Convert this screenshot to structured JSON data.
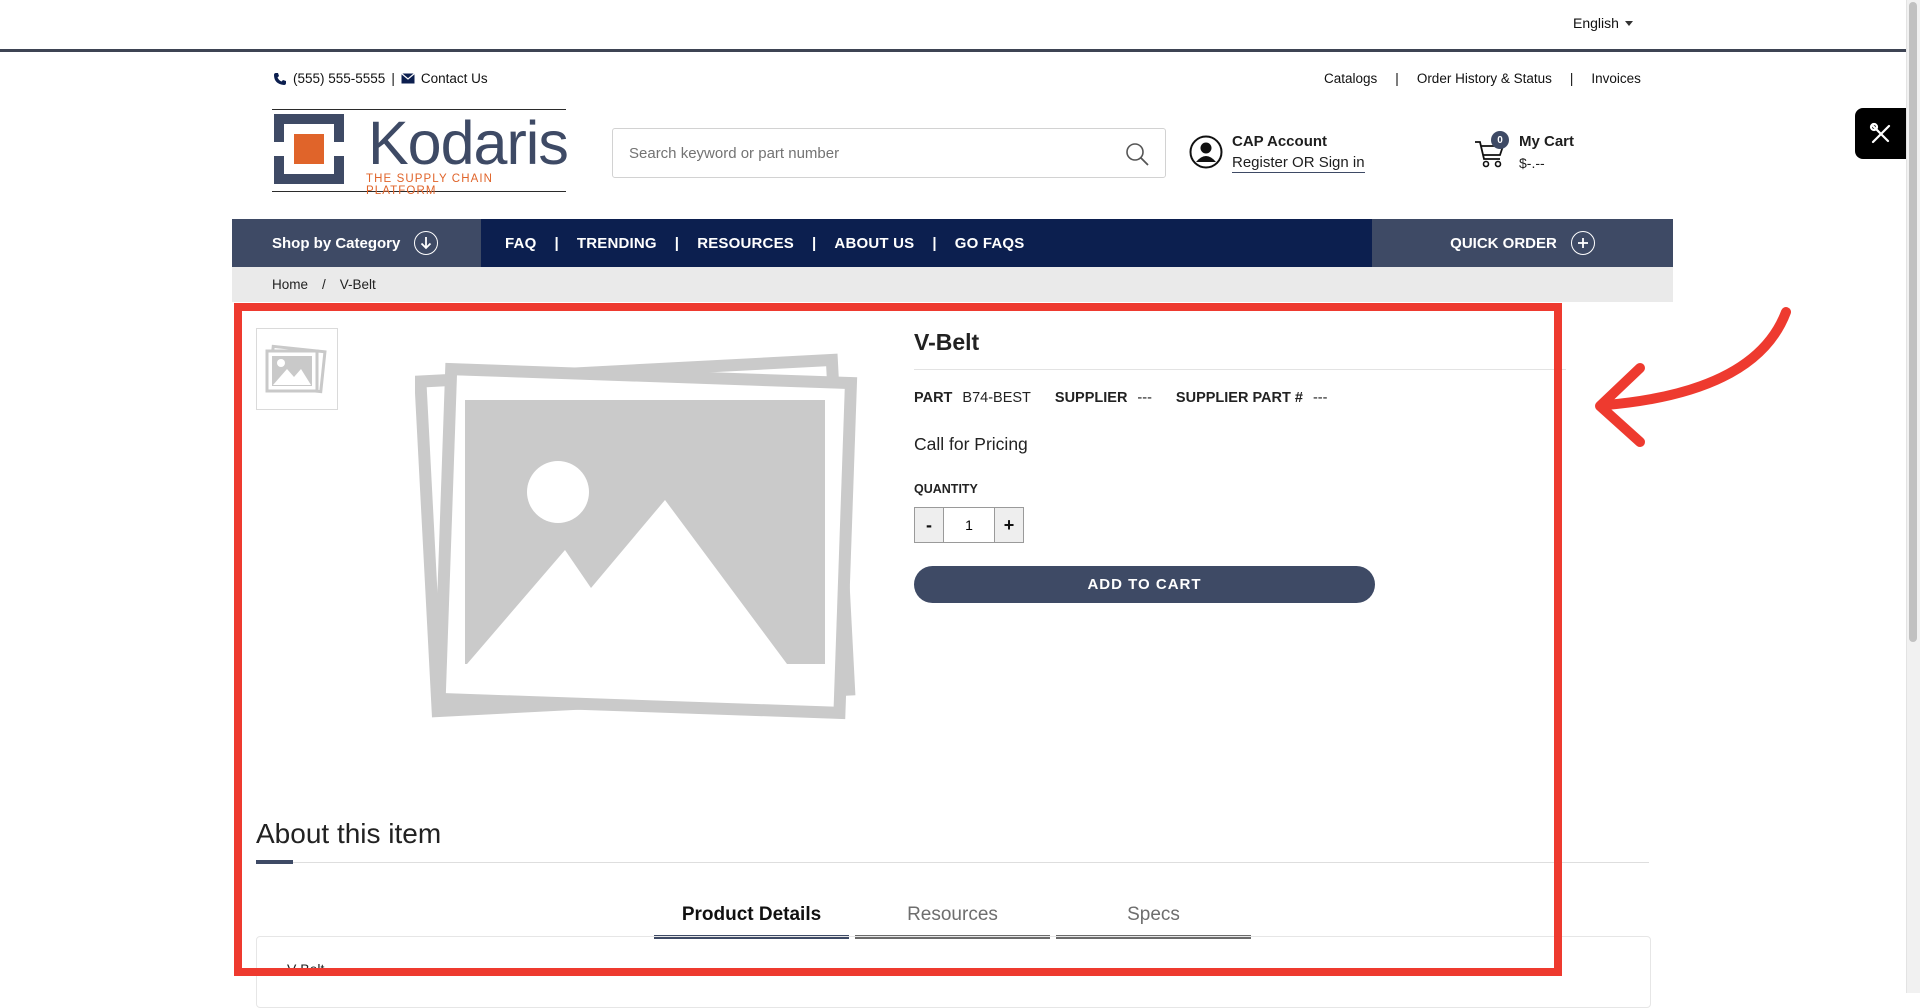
{
  "language": {
    "selected": "English"
  },
  "utility": {
    "phone": "(555) 555-5555",
    "separator": "|",
    "contact": "Contact Us",
    "links": [
      "Catalogs",
      "Order History & Status",
      "Invoices"
    ]
  },
  "logo": {
    "name": "Kodaris",
    "tagline": "THE SUPPLY CHAIN PLATFORM"
  },
  "search": {
    "placeholder": "Search keyword or part number"
  },
  "account": {
    "title": "CAP Account",
    "link": "Register OR Sign in"
  },
  "cart": {
    "count": "0",
    "title": "My Cart",
    "total": "$-.--"
  },
  "nav": {
    "shop_by_category": "Shop by Category",
    "items": [
      "FAQ",
      "TRENDING",
      "RESOURCES",
      "ABOUT US",
      "GO FAQS"
    ],
    "separator": "|",
    "quick_order": "QUICK ORDER"
  },
  "breadcrumb": {
    "home": "Home",
    "separator": "/",
    "current": "V-Belt"
  },
  "product": {
    "title": "V-Belt",
    "part_label": "PART",
    "part_value": "B74-BEST",
    "supplier_label": "SUPPLIER",
    "supplier_value": "---",
    "supplier_part_label": "SUPPLIER PART #",
    "supplier_part_value": "---",
    "pricing": "Call for Pricing",
    "quantity_label": "QUANTITY",
    "quantity": "1",
    "minus": "-",
    "plus": "+",
    "add_to_cart": "ADD TO CART"
  },
  "about": {
    "heading": "About this item",
    "tabs": [
      "Product Details",
      "Resources",
      "Specs"
    ],
    "active_tab": "Product Details",
    "detail_text": "V-Belt"
  },
  "colors": {
    "brand": "#3e4a65",
    "nav": "#0c1f4f",
    "accent": "#e0642a",
    "highlight": "#ee3a2f"
  }
}
